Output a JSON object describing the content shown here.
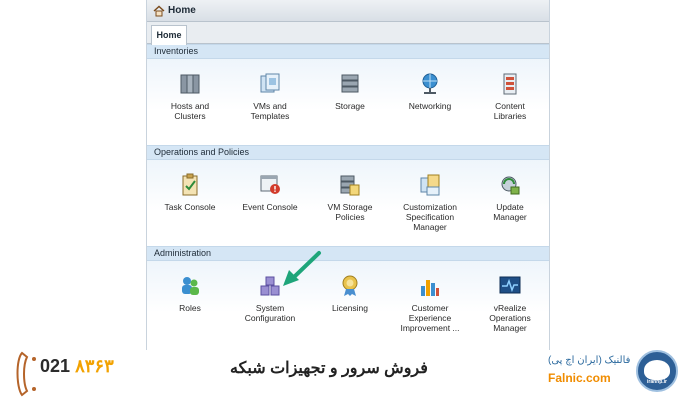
{
  "window": {
    "title": "Home",
    "tab": "Home"
  },
  "sections": [
    {
      "header": "Inventories",
      "items": [
        {
          "label": "Hosts and\nClusters",
          "icon": "hosts-clusters-icon"
        },
        {
          "label": "VMs and\nTemplates",
          "icon": "vms-templates-icon"
        },
        {
          "label": "Storage",
          "icon": "storage-icon"
        },
        {
          "label": "Networking",
          "icon": "networking-icon"
        },
        {
          "label": "Content\nLibraries",
          "icon": "content-libraries-icon"
        }
      ]
    },
    {
      "header": "Operations and Policies",
      "items": [
        {
          "label": "Task Console",
          "icon": "task-console-icon"
        },
        {
          "label": "Event Console",
          "icon": "event-console-icon"
        },
        {
          "label": "VM Storage\nPolicies",
          "icon": "vm-storage-policies-icon"
        },
        {
          "label": "Customization\nSpecification\nManager",
          "icon": "customization-spec-icon"
        },
        {
          "label": "Update\nManager",
          "icon": "update-manager-icon"
        }
      ]
    },
    {
      "header": "Administration",
      "items": [
        {
          "label": "Roles",
          "icon": "roles-icon"
        },
        {
          "label": "System\nConfiguration",
          "icon": "system-configuration-icon"
        },
        {
          "label": "Licensing",
          "icon": "licensing-icon"
        },
        {
          "label": "Customer\nExperience\nImprovement ...",
          "icon": "ceip-icon"
        },
        {
          "label": "vRealize\nOperations\nManager",
          "icon": "vrealize-icon"
        }
      ]
    }
  ],
  "banner": {
    "phone_prefix": "021",
    "phone_number": "۸۳۶۳",
    "tagline": "فروش سرور و تجهیزات شبکه",
    "brand_fa": "فالنیک (ایران اچ پی)",
    "brand_en": "Falnic.com",
    "logo_text": "iranhp.ir"
  },
  "colors": {
    "section_header_bg": "#d5e6f5",
    "accent_orange": "#f2a200",
    "arrow_green": "#1ea57a"
  }
}
